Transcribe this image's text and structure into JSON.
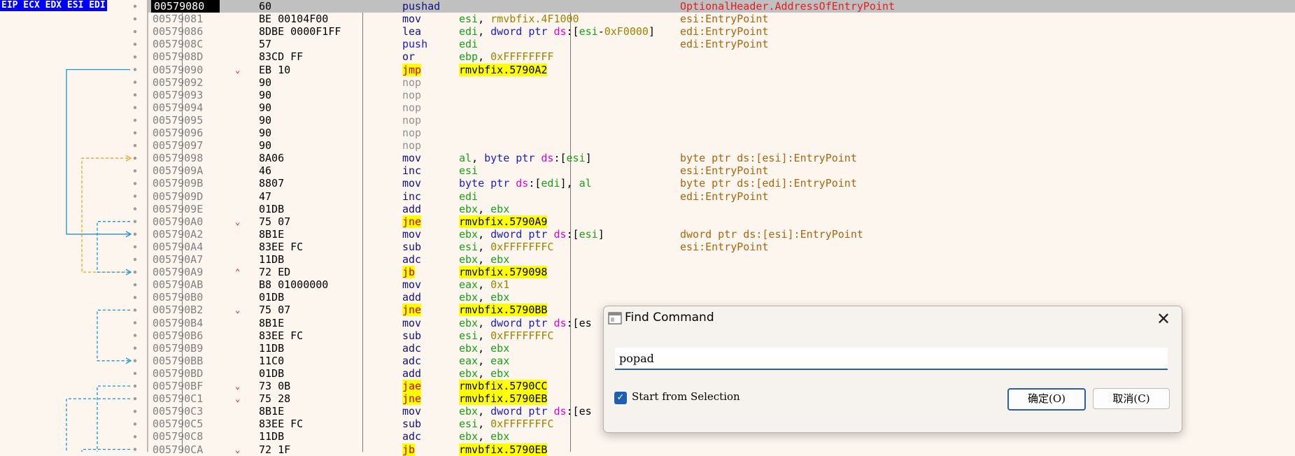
{
  "gutter": {
    "register_labels": "EIP ECX EDX ESI EDI"
  },
  "rows": [
    {
      "addr": "00579080",
      "arrow": "",
      "bytes": "60",
      "mnem": "pushad",
      "mclass": "pushad",
      "ops": [],
      "comment": "OptionalHeader.AddressOfEntryPoint",
      "comment_color": "#e02020",
      "selected": true
    },
    {
      "addr": "00579081",
      "arrow": "",
      "bytes": "BE 00104F00",
      "mnem": "mov",
      "mclass": "mov",
      "ops": [
        [
          "esi",
          "reg"
        ],
        [
          ", ",
          "def"
        ],
        [
          "rmvbfix.4F1000",
          "sym"
        ]
      ],
      "comment": "esi:EntryPoint"
    },
    {
      "addr": "00579086",
      "arrow": "",
      "bytes": "8DBE 0000F1FF",
      "mnem": "lea",
      "mclass": "lea",
      "ops": [
        [
          "edi",
          "reg"
        ],
        [
          ", ",
          "def"
        ],
        [
          "dword ptr ",
          "ptr"
        ],
        [
          "ds",
          "seg"
        ],
        [
          ":[",
          "def"
        ],
        [
          "esi",
          "reg"
        ],
        [
          "-",
          "def"
        ],
        [
          "0xF0000",
          "num"
        ],
        [
          "]",
          "def"
        ]
      ],
      "comment": "edi:EntryPoint"
    },
    {
      "addr": "0057908C",
      "arrow": "",
      "bytes": "57",
      "mnem": "push",
      "mclass": "push",
      "ops": [
        [
          "edi",
          "reg"
        ]
      ],
      "comment": "edi:EntryPoint"
    },
    {
      "addr": "0057908D",
      "arrow": "",
      "bytes": "83CD FF",
      "mnem": "or",
      "mclass": "or",
      "ops": [
        [
          "ebp",
          "reg"
        ],
        [
          ", ",
          "def"
        ],
        [
          "0xFFFFFFFF",
          "num"
        ]
      ],
      "comment": ""
    },
    {
      "addr": "00579090",
      "arrow": "v",
      "bytes": "EB 10",
      "mnem": "jmp",
      "mclass": "jmp",
      "hl": true,
      "ops": [
        [
          "rmvbfix.5790A2",
          "def",
          "hl"
        ]
      ],
      "comment": ""
    },
    {
      "addr": "00579092",
      "arrow": "",
      "bytes": "90",
      "mnem": "nop",
      "mclass": "nop",
      "ops": [],
      "comment": ""
    },
    {
      "addr": "00579093",
      "arrow": "",
      "bytes": "90",
      "mnem": "nop",
      "mclass": "nop",
      "ops": [],
      "comment": ""
    },
    {
      "addr": "00579094",
      "arrow": "",
      "bytes": "90",
      "mnem": "nop",
      "mclass": "nop",
      "ops": [],
      "comment": ""
    },
    {
      "addr": "00579095",
      "arrow": "",
      "bytes": "90",
      "mnem": "nop",
      "mclass": "nop",
      "ops": [],
      "comment": ""
    },
    {
      "addr": "00579096",
      "arrow": "",
      "bytes": "90",
      "mnem": "nop",
      "mclass": "nop",
      "ops": [],
      "comment": ""
    },
    {
      "addr": "00579097",
      "arrow": "",
      "bytes": "90",
      "mnem": "nop",
      "mclass": "nop",
      "ops": [],
      "comment": ""
    },
    {
      "addr": "00579098",
      "arrow": "",
      "bytes": "8A06",
      "mnem": "mov",
      "mclass": "mov",
      "ops": [
        [
          "al",
          "reg"
        ],
        [
          ", ",
          "def"
        ],
        [
          "byte ptr ",
          "ptr"
        ],
        [
          "ds",
          "seg"
        ],
        [
          ":[",
          "def"
        ],
        [
          "esi",
          "reg"
        ],
        [
          "]",
          "def"
        ]
      ],
      "comment": "byte ptr ds:[esi]:EntryPoint"
    },
    {
      "addr": "0057909A",
      "arrow": "",
      "bytes": "46",
      "mnem": "inc",
      "mclass": "inc",
      "ops": [
        [
          "esi",
          "reg"
        ]
      ],
      "comment": "esi:EntryPoint"
    },
    {
      "addr": "0057909B",
      "arrow": "",
      "bytes": "8807",
      "mnem": "mov",
      "mclass": "mov",
      "ops": [
        [
          "byte ptr ",
          "ptr"
        ],
        [
          "ds",
          "seg"
        ],
        [
          ":[",
          "def"
        ],
        [
          "edi",
          "reg"
        ],
        [
          "], ",
          "def"
        ],
        [
          "al",
          "reg"
        ]
      ],
      "comment": "byte ptr ds:[edi]:EntryPoint"
    },
    {
      "addr": "0057909D",
      "arrow": "",
      "bytes": "47",
      "mnem": "inc",
      "mclass": "inc",
      "ops": [
        [
          "edi",
          "reg"
        ]
      ],
      "comment": "edi:EntryPoint"
    },
    {
      "addr": "0057909E",
      "arrow": "",
      "bytes": "01DB",
      "mnem": "add",
      "mclass": "add",
      "ops": [
        [
          "ebx",
          "reg"
        ],
        [
          ", ",
          "def"
        ],
        [
          "ebx",
          "reg"
        ]
      ],
      "comment": ""
    },
    {
      "addr": "005790A0",
      "arrow": "v",
      "bytes": "75 07",
      "mnem": "jne",
      "mclass": "jcc",
      "hl": true,
      "ops": [
        [
          "rmvbfix.5790A9",
          "def",
          "hl"
        ]
      ],
      "comment": ""
    },
    {
      "addr": "005790A2",
      "arrow": "",
      "bytes": "8B1E",
      "mnem": "mov",
      "mclass": "mov",
      "ops": [
        [
          "ebx",
          "reg"
        ],
        [
          ", ",
          "def"
        ],
        [
          "dword ptr ",
          "ptr"
        ],
        [
          "ds",
          "seg"
        ],
        [
          ":[",
          "def"
        ],
        [
          "esi",
          "reg"
        ],
        [
          "]",
          "def"
        ]
      ],
      "comment": "dword ptr ds:[esi]:EntryPoint"
    },
    {
      "addr": "005790A4",
      "arrow": "",
      "bytes": "83EE FC",
      "mnem": "sub",
      "mclass": "sub",
      "ops": [
        [
          "esi",
          "reg"
        ],
        [
          ", ",
          "def"
        ],
        [
          "0xFFFFFFFC",
          "num"
        ]
      ],
      "comment": "esi:EntryPoint"
    },
    {
      "addr": "005790A7",
      "arrow": "",
      "bytes": "11DB",
      "mnem": "adc",
      "mclass": "adc",
      "ops": [
        [
          "ebx",
          "reg"
        ],
        [
          ", ",
          "def"
        ],
        [
          "ebx",
          "reg"
        ]
      ],
      "comment": ""
    },
    {
      "addr": "005790A9",
      "arrow": "^",
      "bytes": "72 ED",
      "mnem": "jb",
      "mclass": "jcc",
      "hl": true,
      "ops": [
        [
          "rmvbfix.579098",
          "def",
          "hl"
        ]
      ],
      "comment": ""
    },
    {
      "addr": "005790AB",
      "arrow": "",
      "bytes": "B8 01000000",
      "mnem": "mov",
      "mclass": "mov",
      "ops": [
        [
          "eax",
          "reg"
        ],
        [
          ", ",
          "def"
        ],
        [
          "0x1",
          "num"
        ]
      ],
      "comment": ""
    },
    {
      "addr": "005790B0",
      "arrow": "",
      "bytes": "01DB",
      "mnem": "add",
      "mclass": "add",
      "ops": [
        [
          "ebx",
          "reg"
        ],
        [
          ", ",
          "def"
        ],
        [
          "ebx",
          "reg"
        ]
      ],
      "comment": ""
    },
    {
      "addr": "005790B2",
      "arrow": "v",
      "bytes": "75 07",
      "mnem": "jne",
      "mclass": "jcc",
      "hl": true,
      "ops": [
        [
          "rmvbfix.5790BB",
          "def",
          "hl"
        ]
      ],
      "comment": ""
    },
    {
      "addr": "005790B4",
      "arrow": "",
      "bytes": "8B1E",
      "mnem": "mov",
      "mclass": "mov",
      "ops": [
        [
          "ebx",
          "reg"
        ],
        [
          ", ",
          "def"
        ],
        [
          "dword ptr ",
          "ptr"
        ],
        [
          "ds",
          "seg"
        ],
        [
          ":[es",
          "def"
        ]
      ],
      "comment": ""
    },
    {
      "addr": "005790B6",
      "arrow": "",
      "bytes": "83EE FC",
      "mnem": "sub",
      "mclass": "sub",
      "ops": [
        [
          "esi",
          "reg"
        ],
        [
          ", ",
          "def"
        ],
        [
          "0xFFFFFFFC",
          "num"
        ]
      ],
      "comment": ""
    },
    {
      "addr": "005790B9",
      "arrow": "",
      "bytes": "11DB",
      "mnem": "adc",
      "mclass": "adc",
      "ops": [
        [
          "ebx",
          "reg"
        ],
        [
          ", ",
          "def"
        ],
        [
          "ebx",
          "reg"
        ]
      ],
      "comment": ""
    },
    {
      "addr": "005790BB",
      "arrow": "",
      "bytes": "11C0",
      "mnem": "adc",
      "mclass": "adc",
      "ops": [
        [
          "eax",
          "reg"
        ],
        [
          ", ",
          "def"
        ],
        [
          "eax",
          "reg"
        ]
      ],
      "comment": ""
    },
    {
      "addr": "005790BD",
      "arrow": "",
      "bytes": "01DB",
      "mnem": "add",
      "mclass": "add",
      "ops": [
        [
          "ebx",
          "reg"
        ],
        [
          ", ",
          "def"
        ],
        [
          "ebx",
          "reg"
        ]
      ],
      "comment": ""
    },
    {
      "addr": "005790BF",
      "arrow": "v",
      "bytes": "73 0B",
      "mnem": "jae",
      "mclass": "jcc",
      "hl": true,
      "ops": [
        [
          "rmvbfix.5790CC",
          "def",
          "hl"
        ]
      ],
      "comment": ""
    },
    {
      "addr": "005790C1",
      "arrow": "v",
      "bytes": "75 28",
      "mnem": "jne",
      "mclass": "jcc",
      "hl": true,
      "ops": [
        [
          "rmvbfix.5790EB",
          "def",
          "hl"
        ]
      ],
      "comment": ""
    },
    {
      "addr": "005790C3",
      "arrow": "",
      "bytes": "8B1E",
      "mnem": "mov",
      "mclass": "mov",
      "ops": [
        [
          "ebx",
          "reg"
        ],
        [
          ", ",
          "def"
        ],
        [
          "dword ptr ",
          "ptr"
        ],
        [
          "ds",
          "seg"
        ],
        [
          ":[es",
          "def"
        ]
      ],
      "comment": ""
    },
    {
      "addr": "005790C5",
      "arrow": "",
      "bytes": "83EE FC",
      "mnem": "sub",
      "mclass": "sub",
      "ops": [
        [
          "esi",
          "reg"
        ],
        [
          ", ",
          "def"
        ],
        [
          "0xFFFFFFFC",
          "num"
        ]
      ],
      "comment": ""
    },
    {
      "addr": "005790C8",
      "arrow": "",
      "bytes": "11DB",
      "mnem": "adc",
      "mclass": "adc",
      "ops": [
        [
          "ebx",
          "reg"
        ],
        [
          ", ",
          "def"
        ],
        [
          "ebx",
          "reg"
        ]
      ],
      "comment": ""
    },
    {
      "addr": "005790CA",
      "arrow": "v",
      "bytes": "72 1F",
      "mnem": "jb",
      "mclass": "jcc",
      "hl": true,
      "ops": [
        [
          "rmvbfix.5790EB",
          "def",
          "hl"
        ]
      ],
      "comment": ""
    }
  ],
  "colors": {
    "background": "#fdf6ef",
    "selected_row": "#c0c0c0",
    "highlight": "#ffff00",
    "jump_arrow_blue": "#1a8fd6",
    "jump_arrow_orange": "#f0a020"
  },
  "dialog": {
    "title": "Find Command",
    "icon": "window-icon",
    "close_glyph": "✕",
    "input_value": "popad",
    "checkbox_label": "Start from Selection",
    "checkbox_checked": true,
    "ok_label": "确定(O)",
    "cancel_label": "取消(C)"
  }
}
